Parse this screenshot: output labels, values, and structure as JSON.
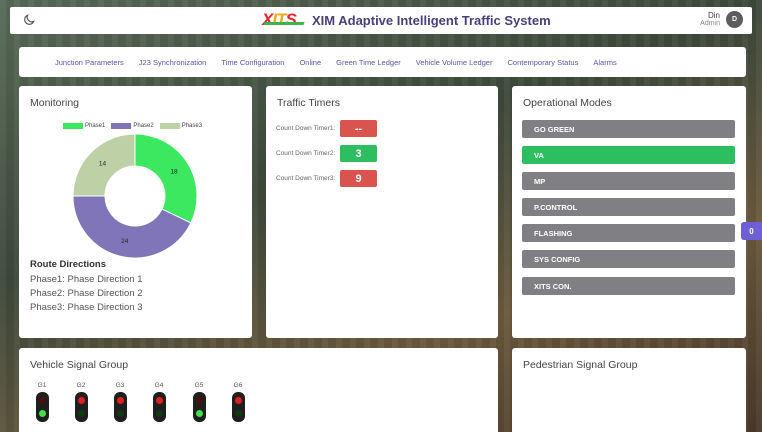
{
  "app": {
    "title": "XIM Adaptive Intelligent Traffic System",
    "logo_text": "XITS",
    "theme_toggle_icon": "moon-icon"
  },
  "user": {
    "name": "Din",
    "role": "Admin",
    "avatar_initial": "D"
  },
  "nav": {
    "items": [
      "Junction Parameters",
      "J23 Synchronization",
      "Time Configuration",
      "Online",
      "Green Time Ledger",
      "Vehicle Volume Ledger",
      "Contemporary Status",
      "Alarms"
    ]
  },
  "monitoring": {
    "title": "Monitoring",
    "routes_title": "Route Directions",
    "routes": [
      "Phase1: Phase Direction 1",
      "Phase2: Phase Direction 2",
      "Phase3: Phase Direction 3"
    ]
  },
  "chart_data": {
    "type": "pie",
    "variant": "doughnut",
    "categories": [
      "Phase1",
      "Phase2",
      "Phase3"
    ],
    "values": [
      18,
      24,
      14
    ],
    "colors": [
      "#3be85f",
      "#8075b8",
      "#bdd0a6"
    ],
    "legend": "top"
  },
  "timers": {
    "title": "Traffic Timers",
    "items": [
      {
        "label": "Count Down Timer1:",
        "value": "--",
        "color": "#d9534f"
      },
      {
        "label": "Count Down Timer2:",
        "value": "3",
        "color": "#2dbe60"
      },
      {
        "label": "Count Down Timer3:",
        "value": "9",
        "color": "#d9534f"
      }
    ]
  },
  "modes": {
    "title": "Operational Modes",
    "items": [
      {
        "label": "GO GREEN",
        "active": false
      },
      {
        "label": "VA",
        "active": true
      },
      {
        "label": "MP",
        "active": false
      },
      {
        "label": "P.CONTROL",
        "active": false
      },
      {
        "label": "FLASHING",
        "active": false
      },
      {
        "label": "SYS CONFIG",
        "active": false
      },
      {
        "label": "XITS CON.",
        "active": false
      }
    ],
    "colors": {
      "active": "#2dbe60",
      "inactive": "#808084"
    }
  },
  "side_badge": "0",
  "vehicle_signals": {
    "title": "Vehicle Signal Group",
    "groups": [
      {
        "label": "G1",
        "state": "green"
      },
      {
        "label": "G2",
        "state": "red"
      },
      {
        "label": "G3",
        "state": "red"
      },
      {
        "label": "G4",
        "state": "red"
      },
      {
        "label": "G5",
        "state": "green"
      },
      {
        "label": "G6",
        "state": "red"
      }
    ]
  },
  "pedestrian_signals": {
    "title": "Pedestrian Signal Group"
  }
}
